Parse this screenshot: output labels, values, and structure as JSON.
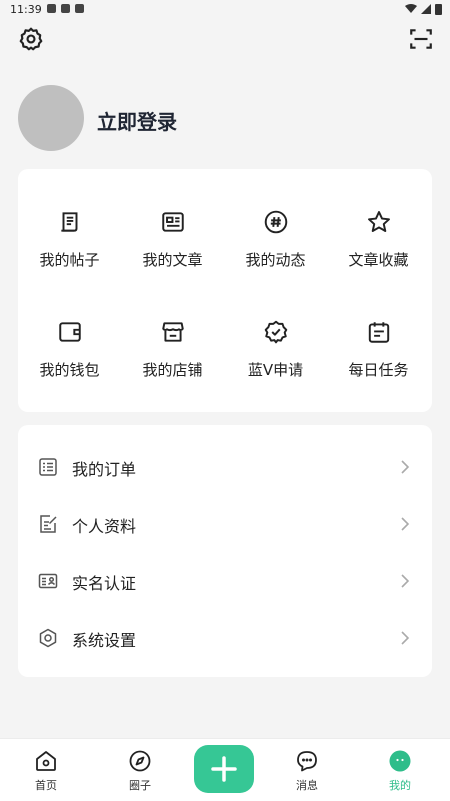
{
  "status_bar": {
    "time": "11:39"
  },
  "header": {
    "login_text": "立即登录"
  },
  "grid": {
    "items": [
      {
        "label": "我的帖子",
        "icon": "posts-icon"
      },
      {
        "label": "我的文章",
        "icon": "article-icon"
      },
      {
        "label": "我的动态",
        "icon": "hashtag-icon"
      },
      {
        "label": "文章收藏",
        "icon": "star-icon"
      },
      {
        "label": "我的钱包",
        "icon": "wallet-icon"
      },
      {
        "label": "我的店铺",
        "icon": "shop-icon"
      },
      {
        "label": "蓝V申请",
        "icon": "badge-check-icon"
      },
      {
        "label": "每日任务",
        "icon": "calendar-task-icon"
      }
    ]
  },
  "menu": {
    "items": [
      {
        "label": "我的订单",
        "icon": "order-list-icon"
      },
      {
        "label": "个人资料",
        "icon": "edit-doc-icon"
      },
      {
        "label": "实名认证",
        "icon": "id-card-icon"
      },
      {
        "label": "系统设置",
        "icon": "hexagon-settings-icon"
      }
    ]
  },
  "tabbar": {
    "items": [
      {
        "label": "首页",
        "icon": "home-icon"
      },
      {
        "label": "圈子",
        "icon": "compass-icon"
      },
      {
        "label": "消息",
        "icon": "message-icon"
      },
      {
        "label": "我的",
        "icon": "profile-icon"
      }
    ],
    "active_color": "#2ebd8a",
    "add_button_color": "#36c795"
  }
}
